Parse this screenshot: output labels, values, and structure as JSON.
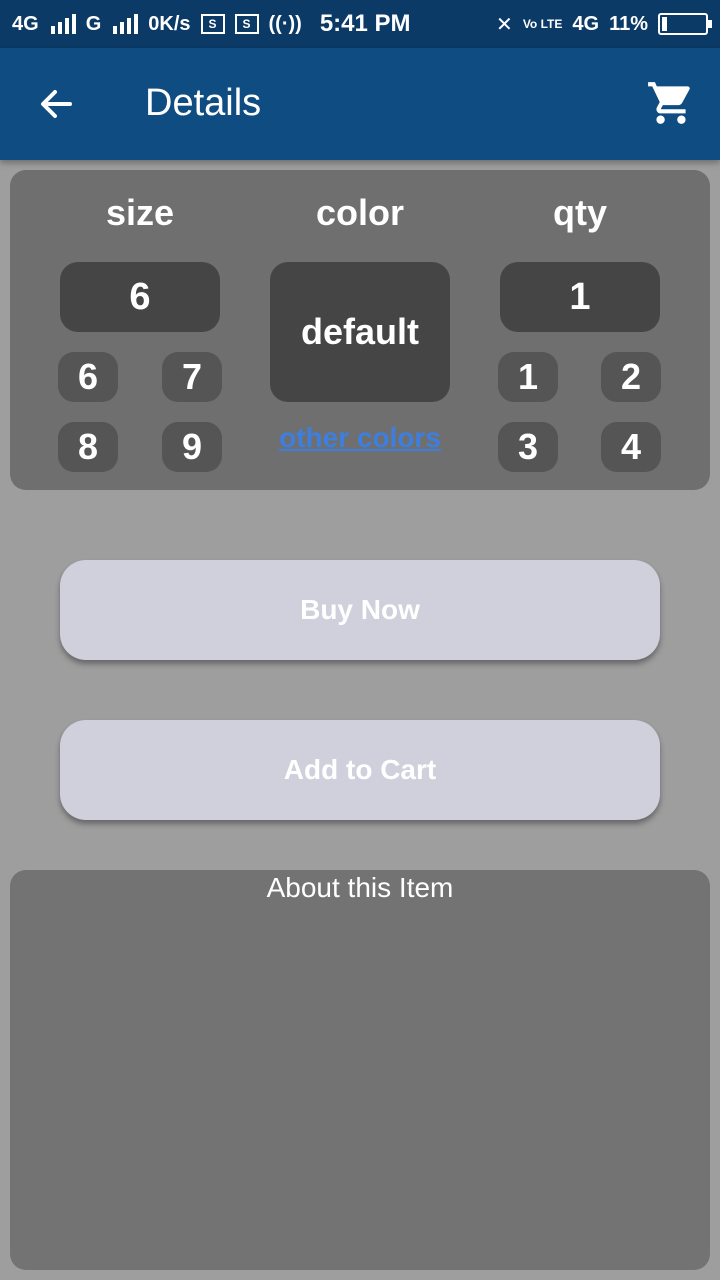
{
  "status_bar": {
    "network1": "4G",
    "network2": "G",
    "speed": "0K/s",
    "sim_icon_label": "S",
    "time": "5:41 PM",
    "volte": "Vo LTE",
    "network3": "4G",
    "battery": "11%"
  },
  "appbar": {
    "title": "Details",
    "back_icon": "arrow-left-icon",
    "cart_icon": "cart-icon"
  },
  "options": {
    "size": {
      "label": "size",
      "selected": "6",
      "choices": [
        "6",
        "7",
        "8",
        "9"
      ]
    },
    "color": {
      "label": "color",
      "selected": "default",
      "other_link": "other colors"
    },
    "qty": {
      "label": "qty",
      "selected": "1",
      "choices": [
        "1",
        "2",
        "3",
        "4"
      ]
    }
  },
  "actions": {
    "buy_now": "Buy Now",
    "add_to_cart": "Add to Cart"
  },
  "about": {
    "title": "About this Item"
  },
  "colors": {
    "appbar": "#0f4c82",
    "statusbar": "#0b3a66",
    "link": "#3d7fe0",
    "background": "#9e9e9e"
  }
}
